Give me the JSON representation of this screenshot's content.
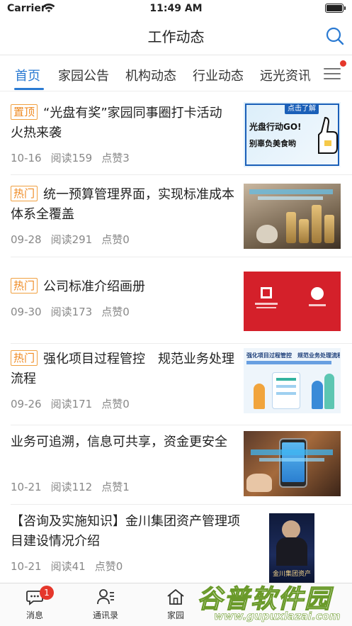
{
  "status": {
    "carrier": "Carrier",
    "time": "11:49 AM"
  },
  "nav": {
    "title": "工作动态"
  },
  "tabs": [
    {
      "label": "首页",
      "active": true
    },
    {
      "label": "家园公告",
      "active": false
    },
    {
      "label": "机构动态",
      "active": false
    },
    {
      "label": "行业动态",
      "active": false
    },
    {
      "label": "远光资讯",
      "active": false
    }
  ],
  "news": [
    {
      "badge": "置顶",
      "title": "“光盘有奖”家园同事圈打卡活动火热来袭",
      "date": "10-16",
      "reads": "阅读159",
      "likes": "点赞3",
      "thumb": {
        "banner": "点击了解",
        "line1": "光盘行动GO!",
        "line2": "别辜负美食哟"
      }
    },
    {
      "badge": "热门",
      "title": "统一预算管理界面，实现标准成本体系全覆盖",
      "date": "09-28",
      "reads": "阅读291",
      "likes": "点赞0"
    },
    {
      "badge": "热门",
      "title": "公司标准介绍画册",
      "date": "09-30",
      "reads": "阅读173",
      "likes": "点赞0"
    },
    {
      "badge": "热门",
      "title": "强化项目过程管控　规范业务处理流程",
      "date": "09-26",
      "reads": "阅读171",
      "likes": "点赞0",
      "thumb": {
        "line1": "强化项目过程管控　规范业务处理流程"
      }
    },
    {
      "badge": "",
      "title": "业务可追溯，信息可共享，资金更安全",
      "date": "10-21",
      "reads": "阅读112",
      "likes": "点赞1"
    },
    {
      "badge": "",
      "title": "【咨询及实施知识】金川集团资产管理项目建设情况介绍",
      "date": "10-21",
      "reads": "阅读41",
      "likes": "点赞0",
      "thumb": {
        "line1": "金川集团资产"
      }
    }
  ],
  "bottom_tabs": [
    {
      "label": "消息",
      "icon": "message-icon",
      "badge": "1"
    },
    {
      "label": "通讯录",
      "icon": "contacts-icon"
    },
    {
      "label": "家园",
      "icon": "home-icon"
    }
  ],
  "watermark": {
    "text": "谷普软件园",
    "url": "www.gupuxlazai.com"
  },
  "colors": {
    "accent": "#2a7ad2",
    "badge": "#ef8a22",
    "notification": "#e5372b"
  }
}
